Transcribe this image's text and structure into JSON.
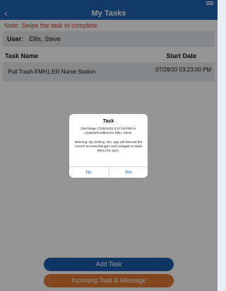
{
  "header": {
    "title": "My Tasks",
    "back_icon": "chevron-left-icon"
  },
  "note": "Note: Swipe the task to complete.",
  "user": {
    "label": "User:",
    "value": "Ellis, Steve"
  },
  "table": {
    "columns": [
      "Task Name",
      "Start Date"
    ],
    "rows": [
      {
        "name": "Pull Trash-FMH1:ER Nurse Station",
        "date": "07/28/20 03:23:00 PM"
      }
    ]
  },
  "buttons": {
    "add_task": "Add Task",
    "incoming": "Incoming Task & Message"
  },
  "dialog": {
    "title": "Task",
    "message_1": "Discharge (7/28/2020 3:27:00 PM) is created/modified for Ellis, Steve.",
    "message_2": "Warning: By clicking Yes, app will discard the current screen/changes and navigate to Main Menu for sync.",
    "no": "No",
    "yes": "Yes"
  },
  "colors": {
    "primary": "#1f63b3",
    "accent": "#e07a34",
    "note": "#d9392b"
  }
}
